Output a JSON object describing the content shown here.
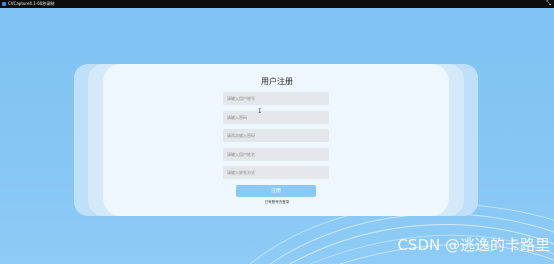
{
  "window": {
    "title": "CVCapture4.1-60秒录制",
    "controls_glyph": "⤡"
  },
  "form": {
    "title": "用户注册",
    "fields": [
      {
        "placeholder": "请输入用户账号"
      },
      {
        "placeholder": "请输入密码"
      },
      {
        "placeholder": "请再次输入密码"
      },
      {
        "placeholder": "请输入用户姓名"
      },
      {
        "placeholder": "请输入联系方式"
      }
    ],
    "submit_label": "注册",
    "login_link": "已有账号去登录"
  },
  "watermark": "CSDN @逃逸的卡路里",
  "colors": {
    "background": "#7fc2f3",
    "card": "#eef7fd",
    "button": "#8ac9f3"
  }
}
